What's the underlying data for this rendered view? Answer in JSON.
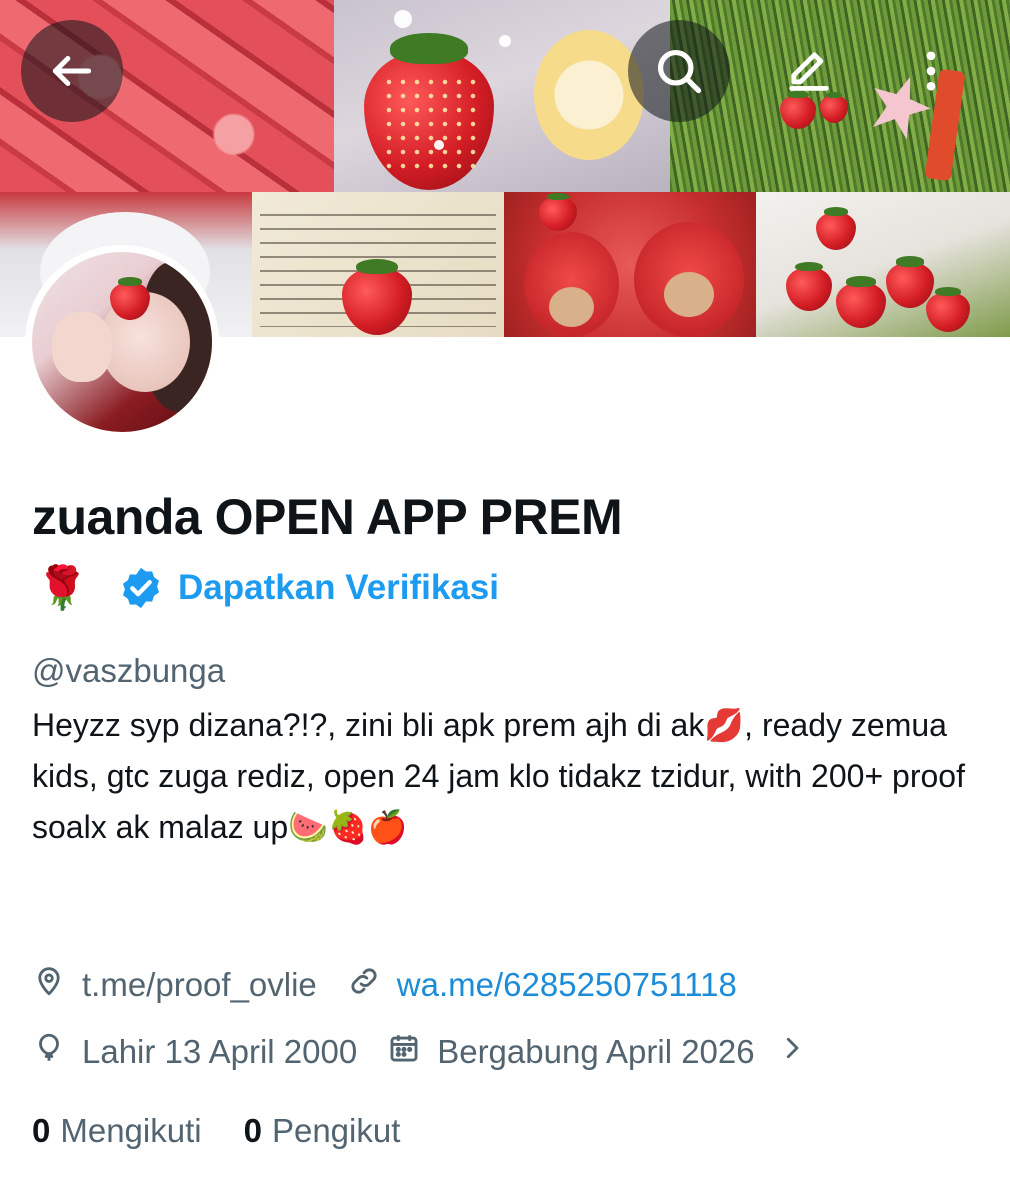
{
  "header": {
    "back_icon": "arrow-left-icon",
    "search_icon": "search-icon",
    "edit_icon": "pencil-icon",
    "more_icon": "more-vertical-icon"
  },
  "profile": {
    "display_name": "zuanda OPEN APP PREM",
    "name_emoji": "🌹",
    "verify_label": "Dapatkan Verifikasi",
    "handle": "@vaszbunga",
    "bio": "Heyzz syp dizana?!?, zini bli apk prem ajh di ak💋, ready zemua kids, gtc zuga rediz, open 24 jam klo tidakz tzidur, with 200+ proof soalx ak malaz up🍉🍓🍎",
    "location": "t.me/proof_ovlie",
    "website": "wa.me/6285250751118",
    "birthday": "Lahir 13 April 2000",
    "joined": "Bergabung April 2026",
    "following_count": "0",
    "following_label": "Mengikuti",
    "followers_count": "0",
    "followers_label": "Pengikut"
  },
  "colors": {
    "accent": "#1d9bf0",
    "link": "#1d8cd8",
    "secondary_text": "#536471",
    "primary_text": "#0f1419"
  }
}
